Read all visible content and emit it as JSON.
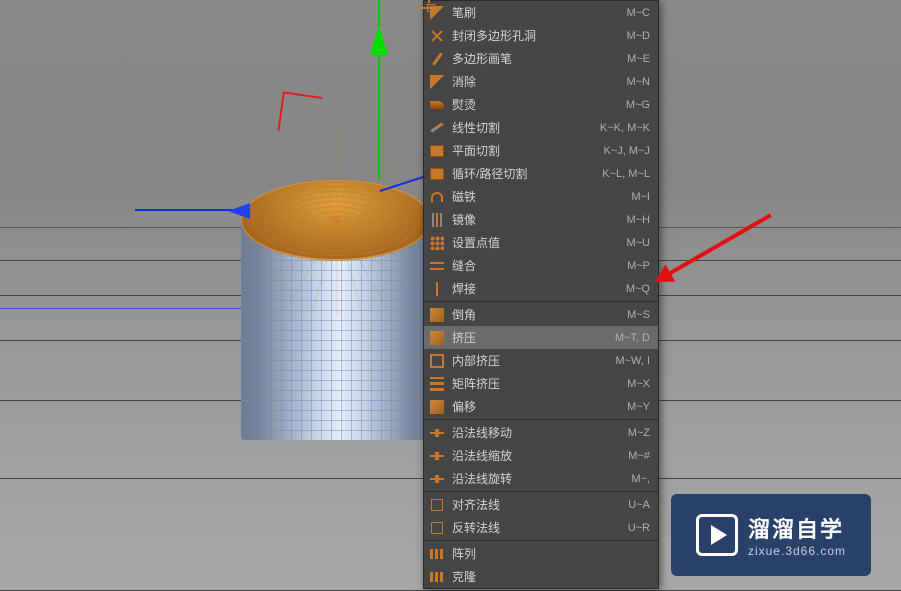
{
  "viewport": {
    "axis_x_color": "#2040f0",
    "axis_y_color": "#00e000",
    "axis_z_color": "#1030e0",
    "gizmo_color": "#e02020",
    "object_wire_color": "#6890d0",
    "object_selected_color": "#d89830"
  },
  "menu": {
    "items": [
      {
        "icon": "brush",
        "label": "笔刷",
        "shortcut": "M~C"
      },
      {
        "icon": "close",
        "label": "封闭多边形孔洞",
        "shortcut": "M~D"
      },
      {
        "icon": "pen",
        "label": "多边形画笔",
        "shortcut": "M~E"
      },
      {
        "icon": "brush",
        "label": "消除",
        "shortcut": "M~N"
      },
      {
        "icon": "iron",
        "label": "熨烫",
        "shortcut": "M~G"
      },
      {
        "icon": "knife",
        "label": "线性切割",
        "shortcut": "K~K, M~K"
      },
      {
        "icon": "box",
        "label": "平面切割",
        "shortcut": "K~J, M~J"
      },
      {
        "icon": "box",
        "label": "循环/路径切割",
        "shortcut": "K~L, M~L"
      },
      {
        "icon": "magnet",
        "label": "磁铁",
        "shortcut": "M~I"
      },
      {
        "icon": "mirror",
        "label": "镜像",
        "shortcut": "M~H"
      },
      {
        "icon": "dots",
        "label": "设置点值",
        "shortcut": "M~U"
      },
      {
        "icon": "stitch",
        "label": "缝合",
        "shortcut": "M~P"
      },
      {
        "icon": "weld",
        "label": "焊接",
        "shortcut": "M~Q"
      },
      {
        "sep": true
      },
      {
        "icon": "cube",
        "label": "倒角",
        "shortcut": "M~S"
      },
      {
        "icon": "cube",
        "label": "挤压",
        "shortcut": "M~T, D",
        "highlight": true
      },
      {
        "icon": "inner",
        "label": "内部挤压",
        "shortcut": "M~W, I"
      },
      {
        "icon": "matrix",
        "label": "矩阵挤压",
        "shortcut": "M~X"
      },
      {
        "icon": "cube",
        "label": "偏移",
        "shortcut": "M~Y"
      },
      {
        "sep": true
      },
      {
        "icon": "slide",
        "label": "沿法线移动",
        "shortcut": "M~Z"
      },
      {
        "icon": "slide",
        "label": "沿法线缩放",
        "shortcut": "M~#"
      },
      {
        "icon": "slide",
        "label": "沿法线旋转",
        "shortcut": "M~,"
      },
      {
        "sep": true
      },
      {
        "icon": "normal",
        "label": "对齐法线",
        "shortcut": "U~A"
      },
      {
        "icon": "normal",
        "label": "反转法线",
        "shortcut": "U~R"
      },
      {
        "sep": true
      },
      {
        "icon": "array",
        "label": "阵列",
        "shortcut": ""
      },
      {
        "icon": "array",
        "label": "克隆",
        "shortcut": ""
      }
    ]
  },
  "annotation": {
    "arrow_color": "#e01010"
  },
  "watermark": {
    "cn": "溜溜自学",
    "en": "zixue.3d66.com"
  }
}
